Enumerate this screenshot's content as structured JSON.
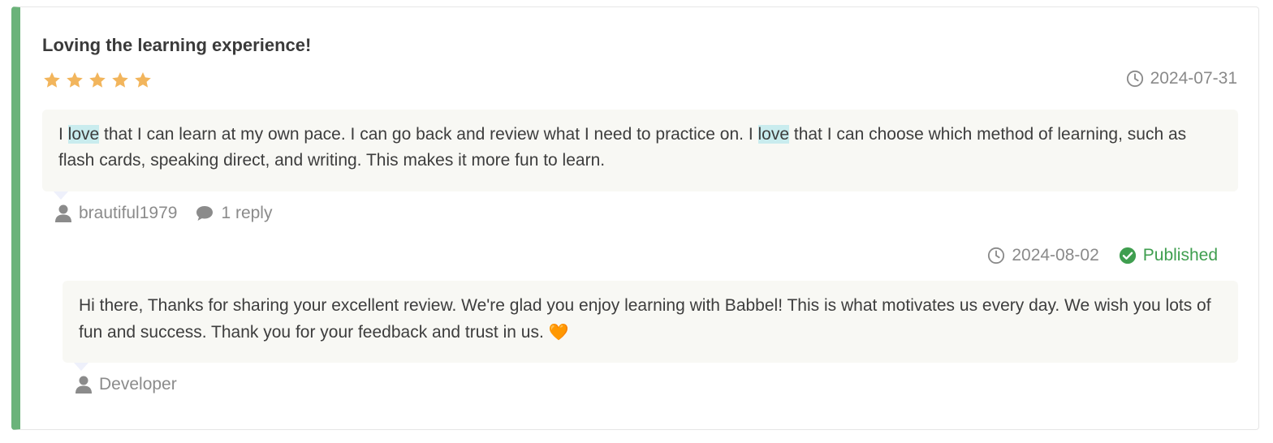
{
  "review": {
    "title": "Loving the learning experience!",
    "rating": 5,
    "rating_max": 5,
    "date": "2024-07-31",
    "body_parts": [
      "I ",
      "love",
      " that I can learn at my own pace. I can go back and review what I need to practice on. I ",
      "love",
      " that I can choose which method of learning, such as flash cards, speaking direct, and writing. This makes it more fun to learn."
    ],
    "highlight_term": "love",
    "author": "brautiful1979",
    "reply_count_label": "1 reply"
  },
  "reply": {
    "date": "2024-08-02",
    "status": "Published",
    "body": "Hi there, Thanks for sharing your excellent review. We're glad you enjoy learning with Babbel! This is what motivates us every day. We wish you lots of fun and success. Thank you for your feedback and trust in us. ",
    "emoji": "🧡",
    "author": "Developer"
  },
  "colors": {
    "accent_bar": "#6bb37a",
    "star": "#f2b55c",
    "highlight": "#c9ecee",
    "published": "#3f9e4f",
    "muted_text": "#8a8a8a"
  },
  "icons": [
    "star-icon",
    "clock-icon",
    "person-icon",
    "comment-icon",
    "check-circle-icon",
    "orange-heart-emoji"
  ]
}
